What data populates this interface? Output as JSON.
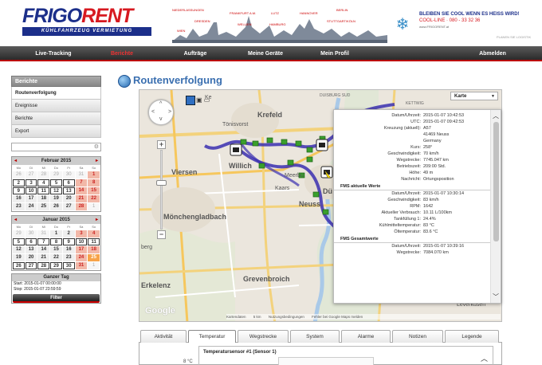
{
  "header": {
    "logo_part1": "FRIGO",
    "logo_part2": "RENT",
    "logo_subtitle": "KÜHLFAHRZEUG VERMIETUNG",
    "ad_line1": "BLEIBEN SIE COOL WENN ES HEISS WIRD!",
    "ad_line2": "COOL-LINE · 080 - 33 32 36",
    "ad_line3": "www.FRIGORENT.at",
    "ad_line4": "PLANEN SIE LOGISTIK",
    "skyline_labels": [
      "NIEDERLASSUNGEN",
      "FRANKFURT A.M.",
      "LUTZ",
      "HANNOVER",
      "BERLIN",
      "DRESDEN",
      "WELLIEN",
      "HAMBURG",
      "STUTTGART/KÖLN",
      "WIEN"
    ]
  },
  "nav": {
    "items": [
      "Live-Tracking",
      "Berichte",
      "Aufträge",
      "Meine Geräte",
      "Mein Profil",
      "Abmelden"
    ],
    "active": "Berichte"
  },
  "sidebar": {
    "header": "Berichte",
    "items": [
      "Routenverfolgung",
      "Ereignisse",
      "Berichte",
      "Export"
    ],
    "selected": "Routenverfolgung",
    "search_icon": "search-icon"
  },
  "calendars": [
    {
      "title": "Februar 2015",
      "weekdays": [
        "Mo",
        "Di",
        "Mi",
        "Do",
        "Fr",
        "Sa",
        "So"
      ],
      "days": [
        "26",
        "27",
        "28",
        "29",
        "30",
        "31",
        "1",
        "2",
        "3",
        "4",
        "5",
        "6",
        "7",
        "8",
        "9",
        "10",
        "11",
        "12",
        "13",
        "14",
        "15",
        "16",
        "17",
        "18",
        "19",
        "20",
        "21",
        "22",
        "23",
        "24",
        "25",
        "26",
        "27",
        "28",
        "1"
      ]
    },
    {
      "title": "Januar 2015",
      "weekdays": [
        "Mo",
        "Di",
        "Mi",
        "Do",
        "Fr",
        "Sa",
        "So"
      ],
      "days": [
        "29",
        "30",
        "31",
        "1",
        "2",
        "3",
        "4",
        "5",
        "6",
        "7",
        "8",
        "9",
        "10",
        "11",
        "12",
        "13",
        "14",
        "15",
        "16",
        "17",
        "18",
        "19",
        "20",
        "21",
        "22",
        "23",
        "24",
        "25",
        "26",
        "27",
        "28",
        "29",
        "30",
        "31",
        "1"
      ]
    }
  ],
  "day_range": {
    "title": "Ganzer Tag",
    "start": "Start: 2015-01-07 00:00:00",
    "stop": "Stop: 2015-01-07 23:59:59",
    "button": "Filter"
  },
  "page_title": "Routenverfolgung",
  "map": {
    "type_select": "Karte",
    "labels": {
      "krefeld": "Krefeld",
      "toenisvorst": "Tönisvorst",
      "viersen": "Viersen",
      "willich": "Willich",
      "moenchengladbach": "Mönchengladbach",
      "neuss": "Neuss",
      "duesseldorf": "Dü",
      "meerbusch": "Meerbu",
      "kaarst": "Kaars",
      "grevenbroich": "Grevenbroich",
      "erkelenz": "Erkelenz",
      "kempen": "Ke",
      "berg": "berg",
      "duisburg": "DUISBURG SUD",
      "kettwig": "KETTWIG",
      "leverkusen": "Leverkusen"
    },
    "google": "Google",
    "credits": [
      "Kartendaten",
      "5 km",
      "Nutzungsbedingungen",
      "Fehler bei Google Maps melden"
    ]
  },
  "popup": {
    "rows1": [
      {
        "k": "Datum/Uhrzeit:",
        "v": "2015-01-07 10:42:53"
      },
      {
        "k": "UTC:",
        "v": "2015-01-07 09:42:53"
      },
      {
        "k": "Kreuzung (aktuell):",
        "v": "A57"
      },
      {
        "k": "",
        "v": "41469 Neuss"
      },
      {
        "k": "",
        "v": "Germany"
      },
      {
        "k": "Kurs:",
        "v": "258°"
      },
      {
        "k": "Geschwindigkeit:",
        "v": "70 km/h"
      },
      {
        "k": "Wegstrecke:",
        "v": "7745.047 km"
      },
      {
        "k": "Betriebszeit:",
        "v": "209:00 Std."
      },
      {
        "k": "Höhe:",
        "v": "49 m"
      },
      {
        "k": "Nachricht:",
        "v": "Ortungsposition"
      }
    ],
    "section2": "FMS aktuelle Werte",
    "rows2": [
      {
        "k": "Datum/Uhrzeit:",
        "v": "2015-01-07 10:30:14"
      },
      {
        "k": "Geschwindigkeit:",
        "v": "83 km/h"
      },
      {
        "k": "RPM:",
        "v": "1642"
      },
      {
        "k": "Aktueller Verbrauch:",
        "v": "10.11 L/100km"
      },
      {
        "k": "Tankfüllung 1:",
        "v": "24.4%"
      },
      {
        "k": "Kühlmitteltemperatur:",
        "v": "83 °C"
      },
      {
        "k": "Öltemperatur:",
        "v": "83.6 °C"
      }
    ],
    "section3": "FMS Gesamtwerte",
    "rows3": [
      {
        "k": "Datum/Uhrzeit:",
        "v": "2015-01-07 10:39:16"
      },
      {
        "k": "Wegstrecke:",
        "v": "7084.070 km"
      }
    ]
  },
  "tabs": [
    "Aktivität",
    "Temperatur",
    "Wegstrecke",
    "System",
    "Alarme",
    "Notizen",
    "Legende"
  ],
  "active_tab": "Temperatur",
  "panel": {
    "title": "Temperatursensor #1 (Sensor 1)",
    "y_label": "8 °C"
  }
}
